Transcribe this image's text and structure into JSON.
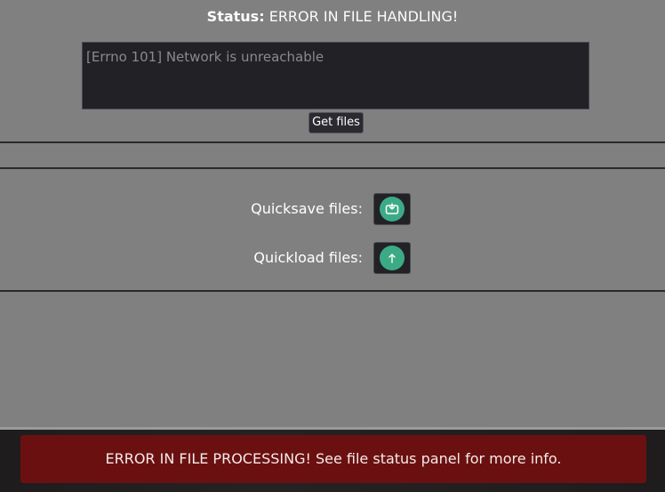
{
  "status": {
    "label": "Status:",
    "value": "ERROR IN FILE HANDLING!"
  },
  "log": {
    "text": "[Errno 101] Network is unreachable"
  },
  "get_files": {
    "label": "Get files"
  },
  "quicksave": {
    "label": "Quicksave files:",
    "icon": "save-icon"
  },
  "quickload": {
    "label": "Quickload files:",
    "icon": "upload-icon"
  },
  "notification": {
    "text": "ERROR IN FILE PROCESSING! See file status panel for more info."
  },
  "colors": {
    "background": "#808080",
    "accent": "#3daa86",
    "error": "#6b1010"
  }
}
